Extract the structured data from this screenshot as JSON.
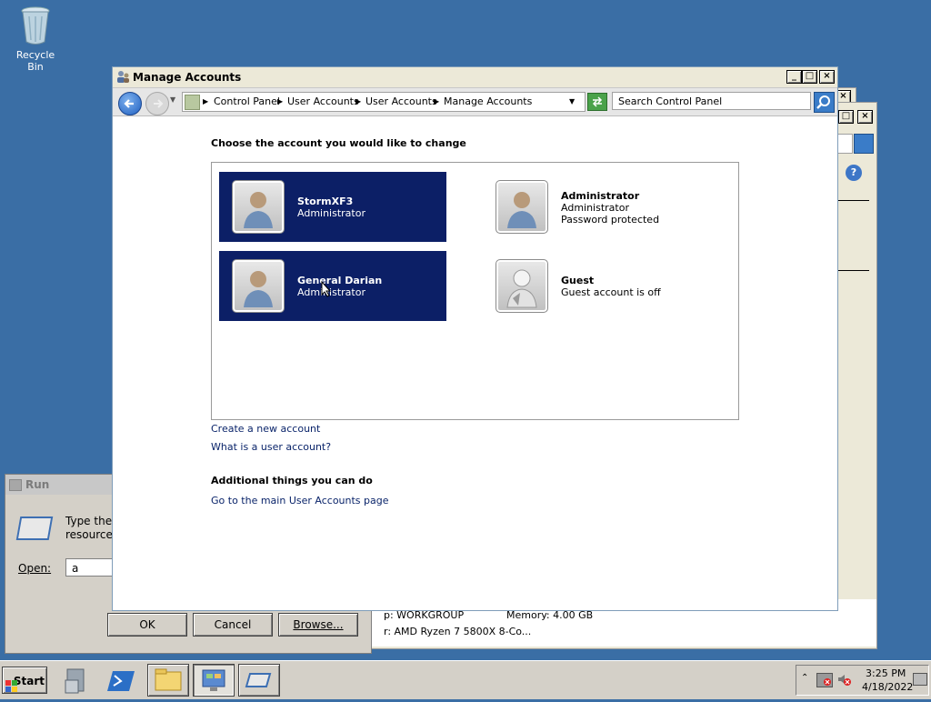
{
  "desktop": {
    "recycle_bin_label": "Recycle Bin"
  },
  "run_dialog": {
    "title": "Run",
    "prompt_line1": "Type the n",
    "prompt_line2": "resource,",
    "open_label": "Open:",
    "open_value": "a",
    "ok_label": "OK",
    "cancel_label": "Cancel",
    "browse_label": "Browse..."
  },
  "background_window": {
    "workgroup_text": "p: WORKGROUP",
    "memory_text": "Memory: 4.00 GB",
    "processor_text": "r: AMD Ryzen 7 5800X 8-Co..."
  },
  "main_window": {
    "title": "Manage Accounts",
    "breadcrumbs": [
      "Control Panel",
      "User Accounts",
      "User Accounts",
      "Manage Accounts"
    ],
    "search_placeholder": "Search Control Panel",
    "heading": "Choose the account you would like to change",
    "accounts": [
      {
        "name": "StormXF3",
        "line1": "Administrator",
        "line2": ""
      },
      {
        "name": "Administrator",
        "line1": "Administrator",
        "line2": "Password protected"
      },
      {
        "name": "General Darian",
        "line1": "Administrator",
        "line2": ""
      },
      {
        "name": "Guest",
        "line1": "Guest account is off",
        "line2": ""
      }
    ],
    "create_link": "Create a new account",
    "what_link": "What is a user account?",
    "additional_heading": "Additional things you can do",
    "main_page_link": "Go to the main User Accounts page"
  },
  "taskbar": {
    "start_label": "Start",
    "time": "3:25 PM",
    "date": "4/18/2022"
  },
  "colors": {
    "desktop": "#3a6ea5",
    "selected_account": "#0c1f66",
    "link": "#0a246a"
  }
}
